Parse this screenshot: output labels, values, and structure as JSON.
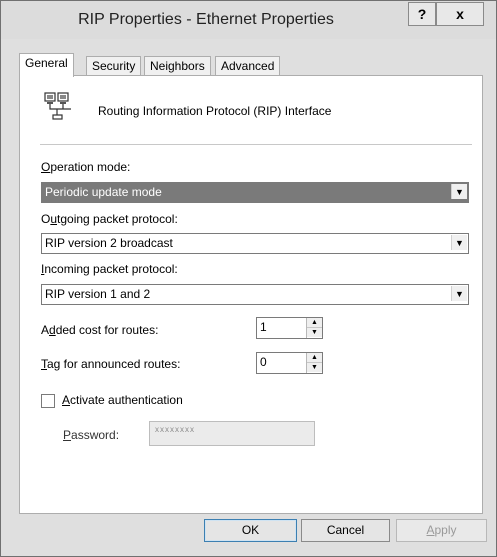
{
  "window": {
    "title": "RIP Properties - Ethernet Properties",
    "help_label": "?",
    "close_label": "x"
  },
  "tabs": [
    {
      "label": "General",
      "active": true
    },
    {
      "label": "Security",
      "active": false
    },
    {
      "label": "Neighbors",
      "active": false
    },
    {
      "label": "Advanced",
      "active": false
    }
  ],
  "header": {
    "icon": "network-interface-icon",
    "text": "Routing Information Protocol (RIP) Interface"
  },
  "fields": {
    "operation_mode": {
      "label_prefix": "",
      "label_ul": "O",
      "label_rest": "peration mode:",
      "value": "Periodic update mode"
    },
    "outgoing": {
      "label_prefix": "O",
      "label_ul": "u",
      "label_rest": "tgoing packet protocol:",
      "value": "RIP version 2 broadcast"
    },
    "incoming": {
      "label_prefix": "",
      "label_ul": "I",
      "label_rest": "ncoming packet protocol:",
      "value": "RIP version 1 and 2"
    },
    "added_cost": {
      "label_prefix": "A",
      "label_ul": "d",
      "label_rest": "ded cost for routes:",
      "value": "1"
    },
    "tag": {
      "label_prefix": "",
      "label_ul": "T",
      "label_rest": "ag for announced routes:",
      "value": "0"
    },
    "activate_auth": {
      "label_prefix": "",
      "label_ul": "A",
      "label_rest": "ctivate authentication",
      "checked": false
    },
    "password": {
      "label_prefix": "",
      "label_ul": "P",
      "label_rest": "assword:",
      "value": "xxxxxxxx"
    }
  },
  "buttons": {
    "ok": "OK",
    "cancel": "Cancel",
    "apply_ul": "A",
    "apply_rest": "pply"
  },
  "colors": {
    "dialog_bg": "#dfdfdf",
    "selected_combo": "#7a7a7a",
    "ok_border": "#3c7fb1"
  }
}
